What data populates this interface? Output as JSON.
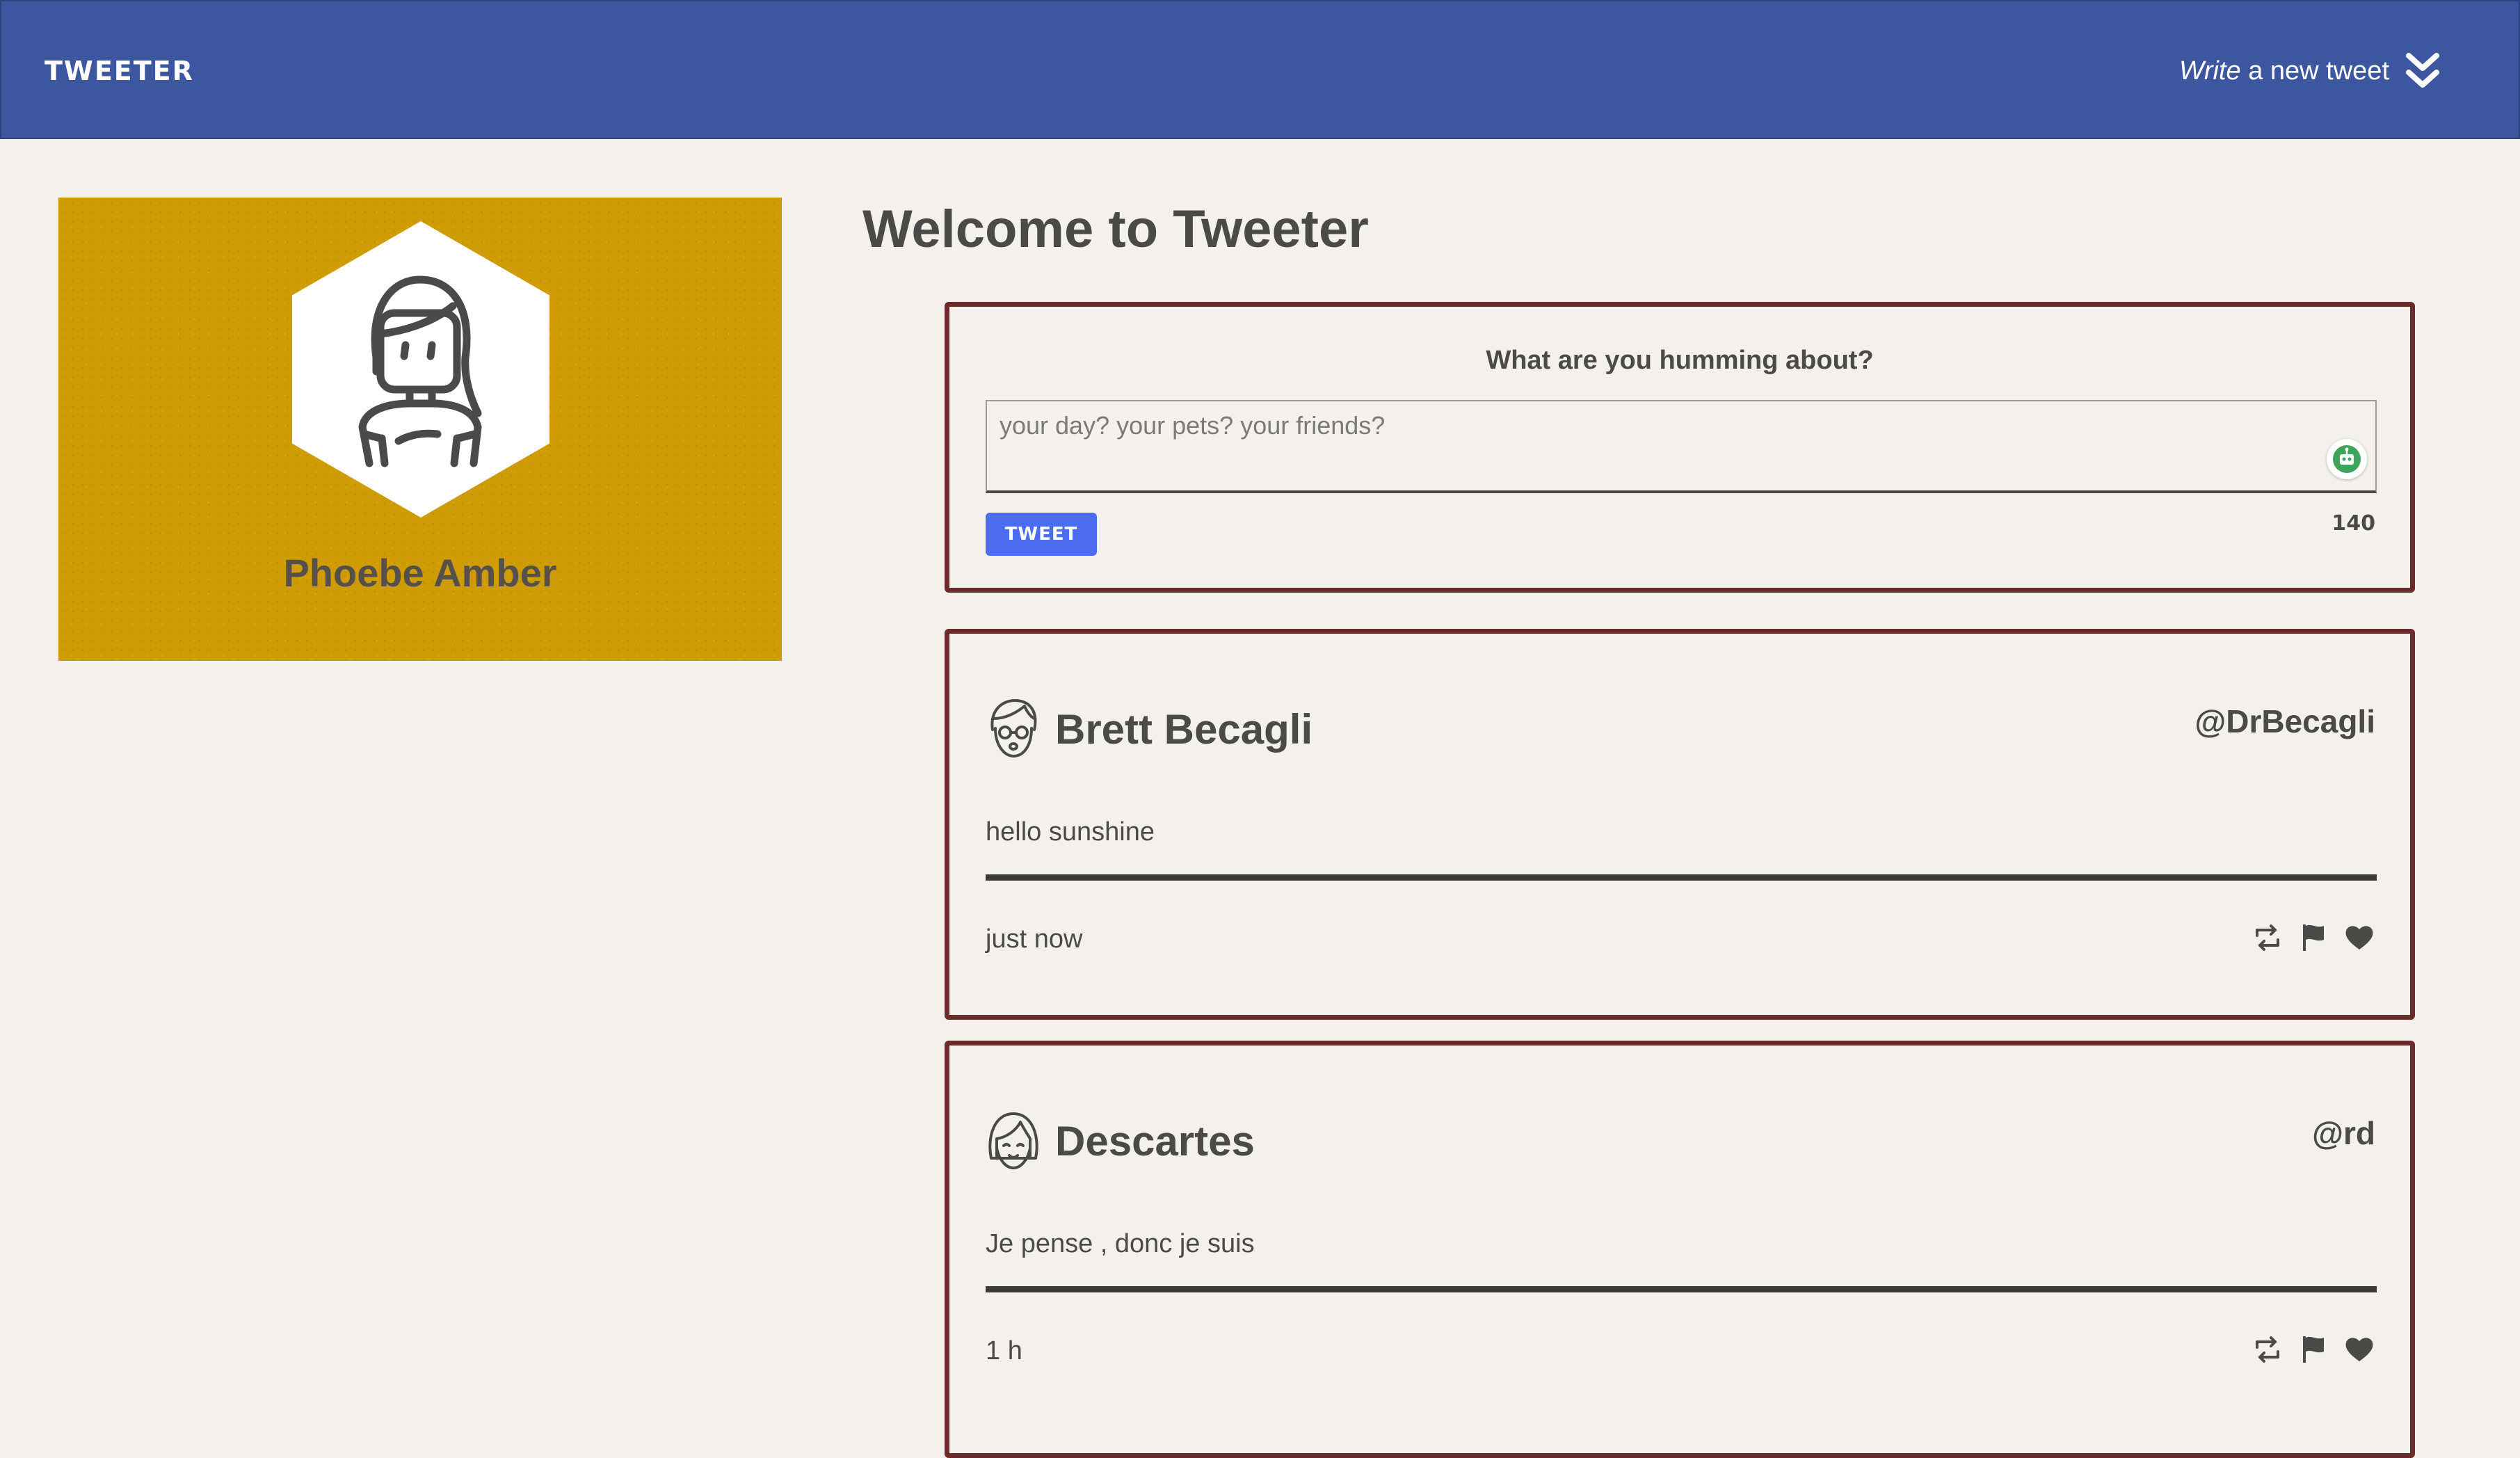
{
  "nav": {
    "brand": "TWEETER",
    "compose_em": "Write",
    "compose_rest": " a new tweet",
    "compose_icon": "double-chevron-down-icon"
  },
  "profile": {
    "name": "Phoebe Amber",
    "avatar_icon": "woman-avatar-icon",
    "background_color": "#cf9c06"
  },
  "main": {
    "title": "Welcome to Tweeter"
  },
  "composer": {
    "label": "What are you humming about?",
    "placeholder": "your day? your pets? your friends?",
    "value": "",
    "button_label": "TWEET",
    "char_count": "140",
    "button_color": "#4c6cf0"
  },
  "tweets": [
    {
      "author": "Brett Becagli",
      "handle": "@DrBecagli",
      "text": "hello sunshine",
      "time": "just now",
      "avatar_icon": "man-glasses-avatar-icon"
    },
    {
      "author": "Descartes",
      "handle": "@rd",
      "text": "Je pense , donc je suis",
      "time": "1 h",
      "avatar_icon": "bob-hair-avatar-icon"
    }
  ],
  "theme": {
    "nav_color": "#3d56a0",
    "card_border": "#6a2c2a",
    "page_background": "#f4f1ec"
  }
}
